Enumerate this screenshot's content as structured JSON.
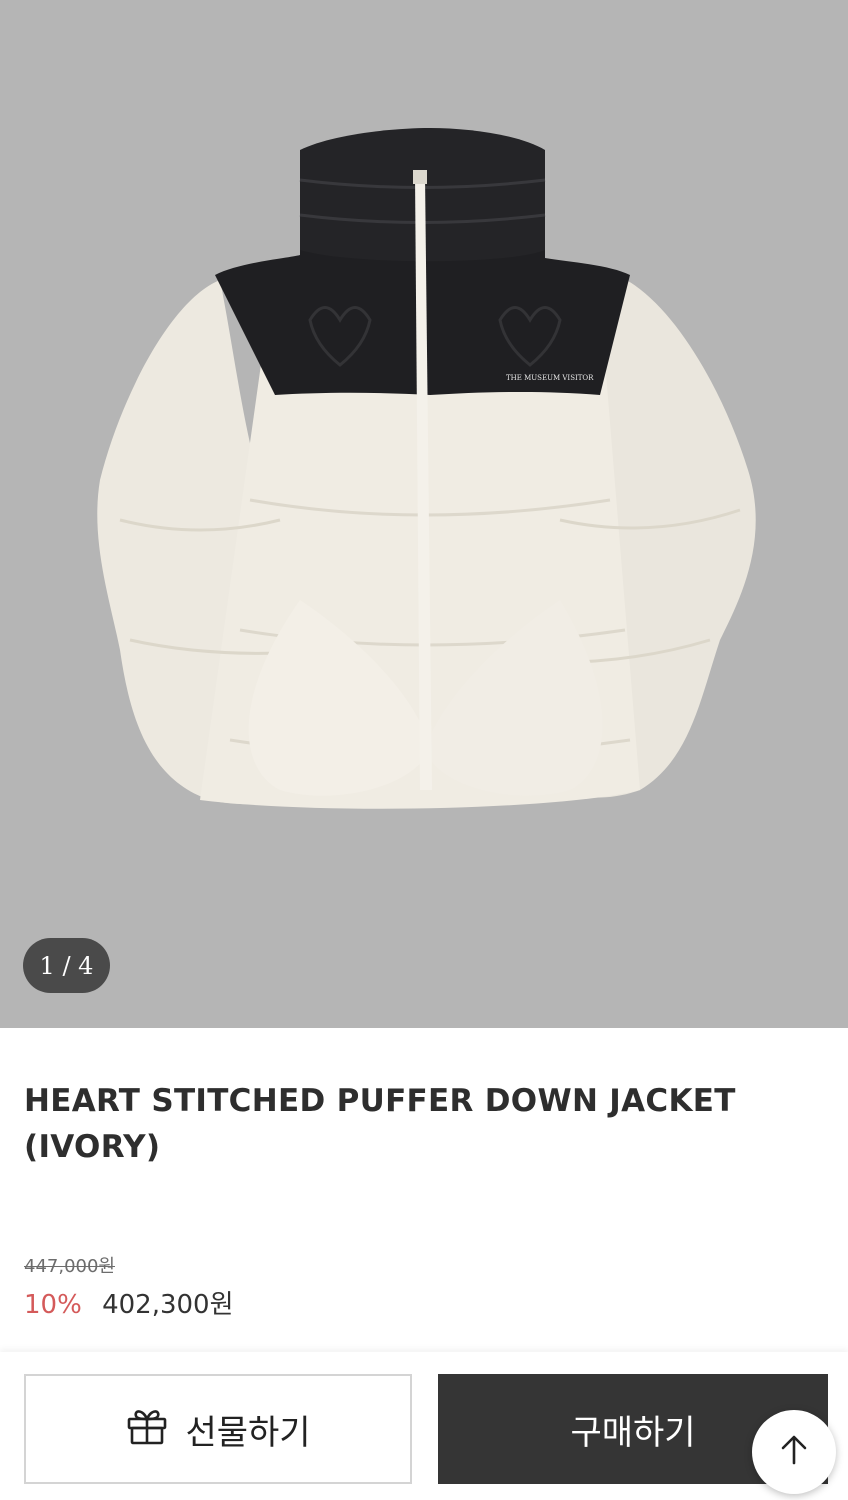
{
  "gallery": {
    "counter": "1 / 4",
    "image_alt": "product-image-puffer-jacket",
    "logo_text": "THE MUSEUM VISITOR"
  },
  "product": {
    "title": "HEART STITCHED PUFFER DOWN JACKET (IVORY)",
    "original_price": "447,000원",
    "discount_rate": "10%",
    "sale_price": "402,300원"
  },
  "actions": {
    "gift_label": "선물하기",
    "buy_label": "구매하기",
    "gift_icon": "gift-icon",
    "top_icon": "arrow-up-icon"
  },
  "colors": {
    "discount": "#d45a5a",
    "buy_button": "#353535",
    "gallery_bg": "#b5b5b5"
  }
}
